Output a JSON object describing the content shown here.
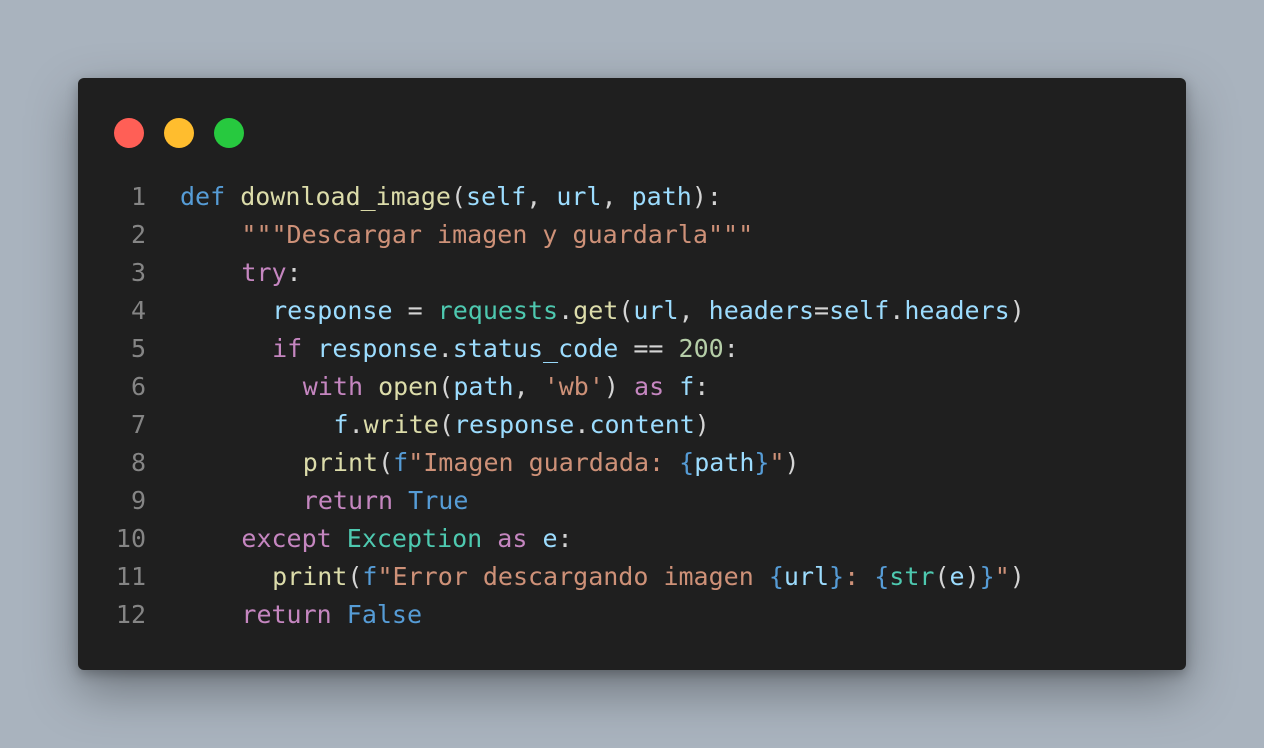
{
  "window": {
    "controls": {
      "close_color": "#ff5f56",
      "minimize_color": "#ffbd2e",
      "maximize_color": "#27c93f"
    }
  },
  "theme": {
    "background": "#1f1f1f",
    "line_number": "#858585",
    "default": "#d4d4d4",
    "keyword": "#569cd6",
    "control": "#c586c0",
    "function": "#dcdcaa",
    "variable": "#9cdcfe",
    "class": "#4ec9b0",
    "string": "#ce9178",
    "number": "#b5cea8"
  },
  "code": {
    "lines": [
      {
        "number": "1",
        "indent": 0,
        "tokens": [
          {
            "t": "def",
            "c": "keyword"
          },
          {
            "t": " ",
            "c": "default"
          },
          {
            "t": "download_image",
            "c": "function"
          },
          {
            "t": "(",
            "c": "default"
          },
          {
            "t": "self",
            "c": "variable"
          },
          {
            "t": ", ",
            "c": "default"
          },
          {
            "t": "url",
            "c": "variable"
          },
          {
            "t": ", ",
            "c": "default"
          },
          {
            "t": "path",
            "c": "variable"
          },
          {
            "t": "):",
            "c": "default"
          }
        ]
      },
      {
        "number": "2",
        "indent": 8,
        "tokens": [
          {
            "t": "\"\"\"Descargar imagen y guardarla\"\"\"",
            "c": "string"
          }
        ]
      },
      {
        "number": "3",
        "indent": 8,
        "tokens": [
          {
            "t": "try",
            "c": "control"
          },
          {
            "t": ":",
            "c": "default"
          }
        ]
      },
      {
        "number": "4",
        "indent": 12,
        "tokens": [
          {
            "t": "response",
            "c": "variable"
          },
          {
            "t": " = ",
            "c": "default"
          },
          {
            "t": "requests",
            "c": "class"
          },
          {
            "t": ".",
            "c": "default"
          },
          {
            "t": "get",
            "c": "function"
          },
          {
            "t": "(",
            "c": "default"
          },
          {
            "t": "url",
            "c": "variable"
          },
          {
            "t": ", ",
            "c": "default"
          },
          {
            "t": "headers",
            "c": "variable"
          },
          {
            "t": "=",
            "c": "default"
          },
          {
            "t": "self",
            "c": "variable"
          },
          {
            "t": ".",
            "c": "default"
          },
          {
            "t": "headers",
            "c": "variable"
          },
          {
            "t": ")",
            "c": "default"
          }
        ]
      },
      {
        "number": "5",
        "indent": 12,
        "tokens": [
          {
            "t": "if",
            "c": "control"
          },
          {
            "t": " ",
            "c": "default"
          },
          {
            "t": "response",
            "c": "variable"
          },
          {
            "t": ".",
            "c": "default"
          },
          {
            "t": "status_code",
            "c": "variable"
          },
          {
            "t": " == ",
            "c": "default"
          },
          {
            "t": "200",
            "c": "number"
          },
          {
            "t": ":",
            "c": "default"
          }
        ]
      },
      {
        "number": "6",
        "indent": 16,
        "tokens": [
          {
            "t": "with",
            "c": "control"
          },
          {
            "t": " ",
            "c": "default"
          },
          {
            "t": "open",
            "c": "function"
          },
          {
            "t": "(",
            "c": "default"
          },
          {
            "t": "path",
            "c": "variable"
          },
          {
            "t": ", ",
            "c": "default"
          },
          {
            "t": "'wb'",
            "c": "string"
          },
          {
            "t": ") ",
            "c": "default"
          },
          {
            "t": "as",
            "c": "control"
          },
          {
            "t": " ",
            "c": "default"
          },
          {
            "t": "f",
            "c": "variable"
          },
          {
            "t": ":",
            "c": "default"
          }
        ]
      },
      {
        "number": "7",
        "indent": 20,
        "tokens": [
          {
            "t": "f",
            "c": "variable"
          },
          {
            "t": ".",
            "c": "default"
          },
          {
            "t": "write",
            "c": "function"
          },
          {
            "t": "(",
            "c": "default"
          },
          {
            "t": "response",
            "c": "variable"
          },
          {
            "t": ".",
            "c": "default"
          },
          {
            "t": "content",
            "c": "variable"
          },
          {
            "t": ")",
            "c": "default"
          }
        ]
      },
      {
        "number": "8",
        "indent": 16,
        "tokens": [
          {
            "t": "print",
            "c": "function"
          },
          {
            "t": "(",
            "c": "default"
          },
          {
            "t": "f",
            "c": "keyword"
          },
          {
            "t": "\"Imagen guardada: ",
            "c": "string"
          },
          {
            "t": "{",
            "c": "keyword"
          },
          {
            "t": "path",
            "c": "variable"
          },
          {
            "t": "}",
            "c": "keyword"
          },
          {
            "t": "\"",
            "c": "string"
          },
          {
            "t": ")",
            "c": "default"
          }
        ]
      },
      {
        "number": "9",
        "indent": 16,
        "tokens": [
          {
            "t": "return",
            "c": "control"
          },
          {
            "t": " ",
            "c": "default"
          },
          {
            "t": "True",
            "c": "keyword"
          }
        ]
      },
      {
        "number": "10",
        "indent": 8,
        "tokens": [
          {
            "t": "except",
            "c": "control"
          },
          {
            "t": " ",
            "c": "default"
          },
          {
            "t": "Exception",
            "c": "class"
          },
          {
            "t": " ",
            "c": "default"
          },
          {
            "t": "as",
            "c": "control"
          },
          {
            "t": " ",
            "c": "default"
          },
          {
            "t": "e",
            "c": "variable"
          },
          {
            "t": ":",
            "c": "default"
          }
        ]
      },
      {
        "number": "11",
        "indent": 12,
        "tokens": [
          {
            "t": "print",
            "c": "function"
          },
          {
            "t": "(",
            "c": "default"
          },
          {
            "t": "f",
            "c": "keyword"
          },
          {
            "t": "\"Error descargando imagen ",
            "c": "string"
          },
          {
            "t": "{",
            "c": "keyword"
          },
          {
            "t": "url",
            "c": "variable"
          },
          {
            "t": "}",
            "c": "keyword"
          },
          {
            "t": ": ",
            "c": "string"
          },
          {
            "t": "{",
            "c": "keyword"
          },
          {
            "t": "str",
            "c": "class"
          },
          {
            "t": "(",
            "c": "default"
          },
          {
            "t": "e",
            "c": "variable"
          },
          {
            "t": ")",
            "c": "default"
          },
          {
            "t": "}",
            "c": "keyword"
          },
          {
            "t": "\"",
            "c": "string"
          },
          {
            "t": ")",
            "c": "default"
          }
        ]
      },
      {
        "number": "12",
        "indent": 8,
        "tokens": [
          {
            "t": "return",
            "c": "control"
          },
          {
            "t": " ",
            "c": "default"
          },
          {
            "t": "False",
            "c": "keyword"
          }
        ]
      }
    ]
  }
}
